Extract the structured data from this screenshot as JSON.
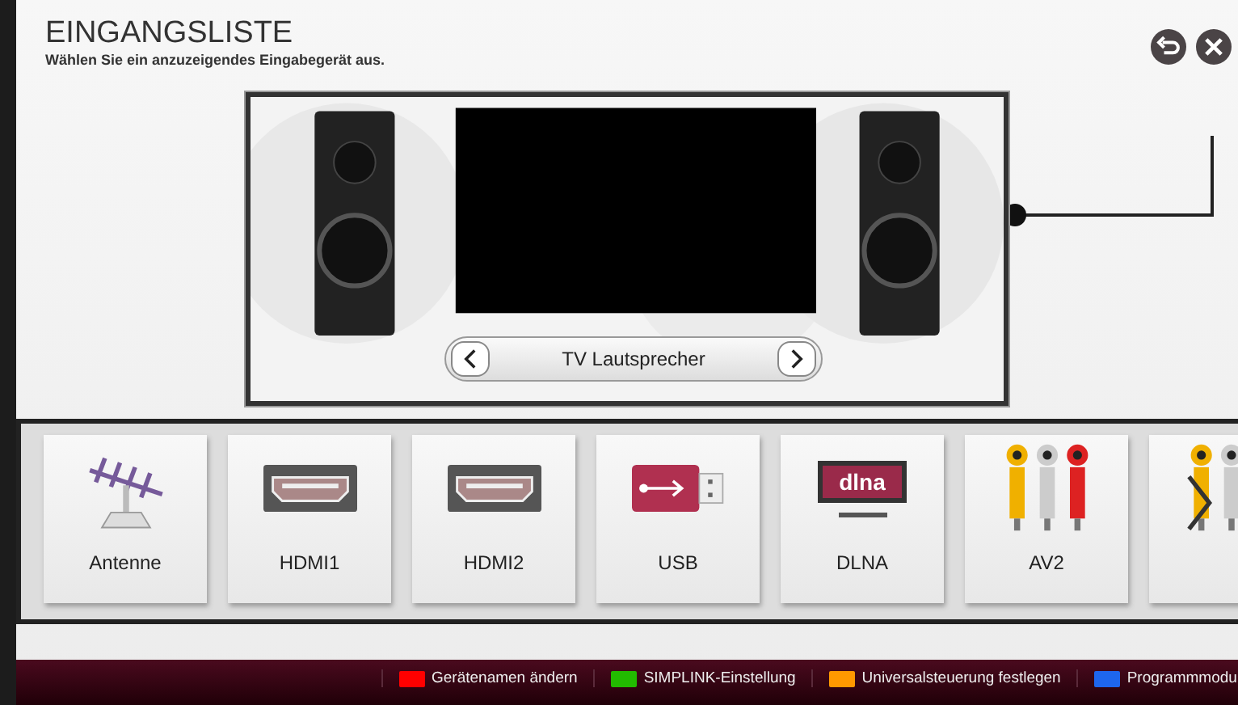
{
  "header": {
    "title": "EINGANGSLISTE",
    "subtitle": "Wählen Sie ein anzuzeigendes Eingabegerät aus."
  },
  "preview": {
    "output": "TV Lautsprecher"
  },
  "inputs": [
    {
      "kind": "antenna",
      "label": "Antenne"
    },
    {
      "kind": "hdmi",
      "label": "HDMI1"
    },
    {
      "kind": "hdmi",
      "label": "HDMI2"
    },
    {
      "kind": "usb",
      "label": "USB"
    },
    {
      "kind": "dlna",
      "label": "DLNA",
      "logo": "dlna"
    },
    {
      "kind": "av",
      "label": "AV2"
    },
    {
      "kind": "av-partial"
    }
  ],
  "footer": [
    {
      "color": "#ff0000",
      "label": "Gerätenamen ändern"
    },
    {
      "color": "#22bb00",
      "label": "SIMPLINK-Einstellung"
    },
    {
      "color": "#ff9900",
      "label": "Universalsteuerung festlegen"
    },
    {
      "color": "#1e66ee",
      "label": "Programmmodu"
    }
  ]
}
